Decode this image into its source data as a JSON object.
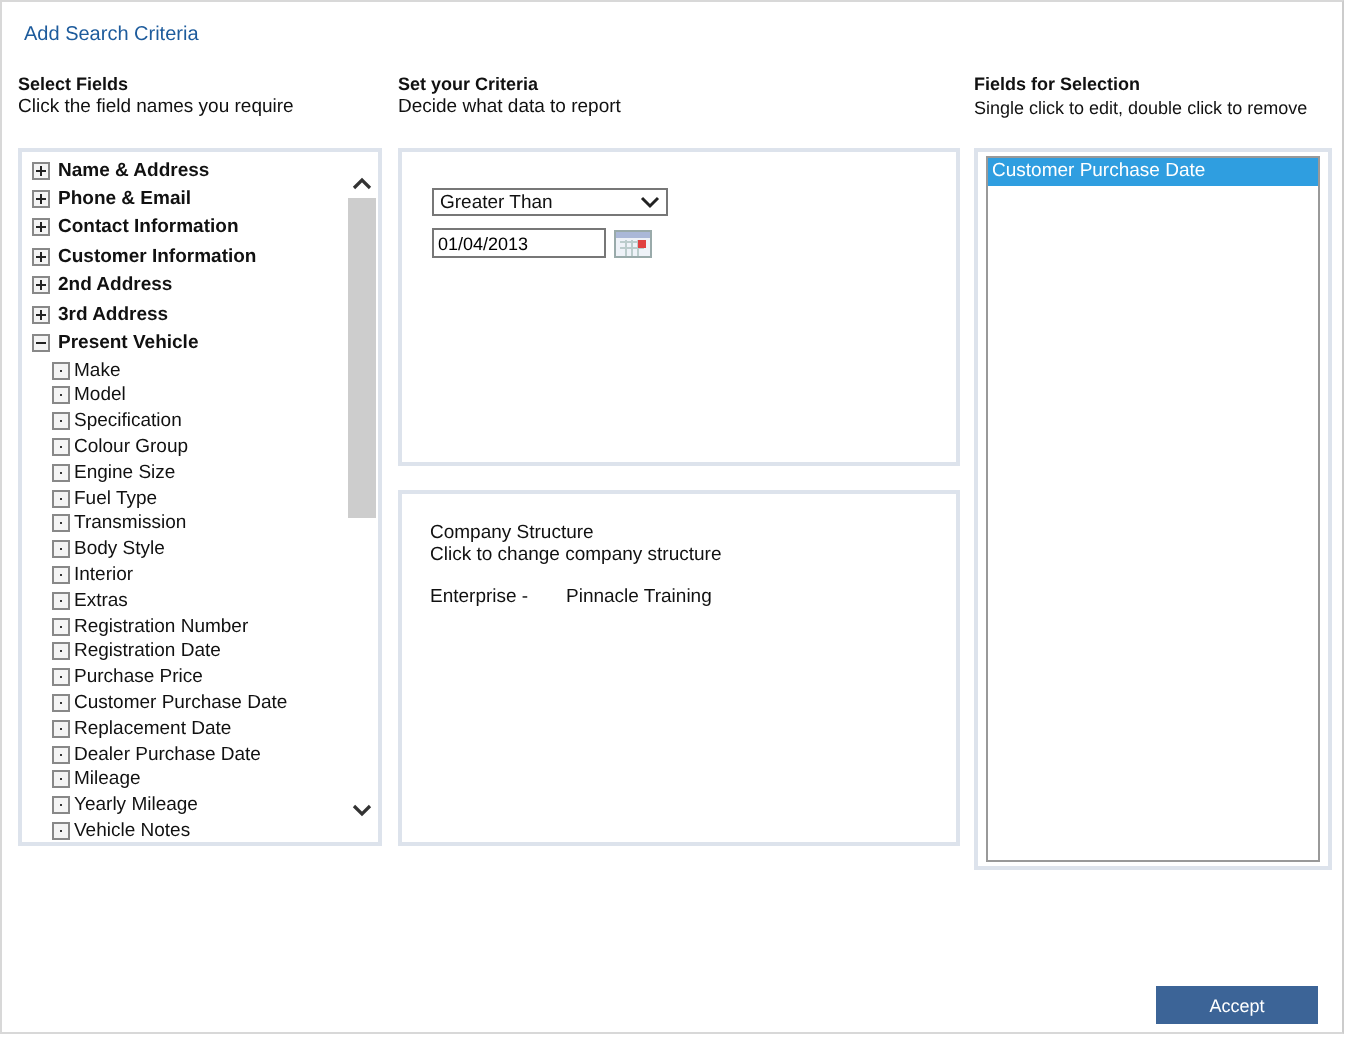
{
  "window": {
    "title": "Add Search Criteria"
  },
  "select_fields": {
    "heading": "Select Fields",
    "hint": "Click the field names you require",
    "tree": [
      {
        "label": "Name & Address",
        "expanded": false
      },
      {
        "label": "Phone & Email",
        "expanded": false
      },
      {
        "label": "Contact Information",
        "expanded": false
      },
      {
        "label": "Customer Information",
        "expanded": false
      },
      {
        "label": "2nd Address",
        "expanded": false
      },
      {
        "label": "3rd Address",
        "expanded": false
      },
      {
        "label": "Present Vehicle",
        "expanded": true,
        "children": [
          {
            "label": "Make"
          },
          {
            "label": "Model"
          },
          {
            "label": "Specification"
          },
          {
            "label": "Colour Group"
          },
          {
            "label": "Engine Size"
          },
          {
            "label": "Fuel Type"
          },
          {
            "label": "Transmission"
          },
          {
            "label": "Body Style"
          },
          {
            "label": "Interior"
          },
          {
            "label": "Extras"
          },
          {
            "label": "Registration Number"
          },
          {
            "label": "Registration Date"
          },
          {
            "label": "Purchase Price"
          },
          {
            "label": "Customer Purchase Date"
          },
          {
            "label": "Replacement Date"
          },
          {
            "label": "Dealer Purchase Date"
          },
          {
            "label": "Mileage"
          },
          {
            "label": "Yearly Mileage"
          },
          {
            "label": "Vehicle Notes"
          }
        ]
      }
    ]
  },
  "criteria": {
    "heading": "Set your Criteria",
    "hint": "Decide what data to report",
    "operator": "Greater Than",
    "date": "01/04/2013"
  },
  "company_structure": {
    "title": "Company Structure",
    "hint": "Click to change company structure",
    "level": "Enterprise -",
    "name": "Pinnacle Training"
  },
  "fields_for_selection": {
    "heading": "Fields for Selection",
    "hint": "Single click to edit, double click to remove",
    "items": [
      {
        "label": "Customer Purchase Date",
        "selected": true
      }
    ]
  },
  "buttons": [
    "Accept"
  ]
}
